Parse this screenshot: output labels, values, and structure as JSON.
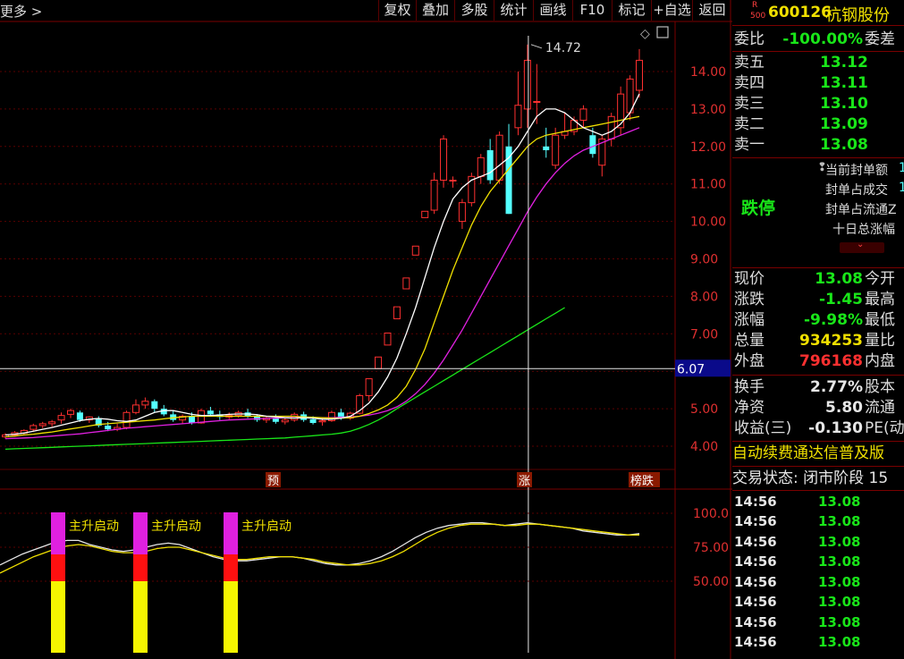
{
  "toolbar": {
    "more": "更多 >",
    "buttons": [
      "复权",
      "叠加",
      "多股",
      "统计",
      "画线",
      "F10",
      "标记",
      "+自选",
      "返回"
    ]
  },
  "chart": {
    "peak_label": "14.72",
    "crosshair_price": "6.07",
    "price_ticks": [
      "14.00",
      "13.00",
      "12.00",
      "11.00",
      "10.00",
      "9.00",
      "8.00",
      "7.00",
      "6.00",
      "5.00",
      "4.00"
    ],
    "indicator_ticks": [
      "100.0",
      "75.00",
      "50.00"
    ],
    "markers": {
      "pre": "预",
      "rise": "涨",
      "rank": "榜跌"
    },
    "signal_label": "主升启动",
    "colors": {
      "up": "#ff3030",
      "down": "#54ffff",
      "ma5": "#ffffff",
      "ma10": "#f0e000",
      "ma20": "#e020e0",
      "ma60": "#19e619"
    }
  },
  "chart_data": {
    "type": "candlestick",
    "ylim": [
      3.5,
      15.2
    ],
    "candles": [
      [
        4.25,
        4.35,
        4.3,
        4.2
      ],
      [
        4.3,
        4.4,
        4.36,
        4.26
      ],
      [
        4.35,
        4.45,
        4.42,
        4.3
      ],
      [
        4.45,
        4.6,
        4.55,
        4.4
      ],
      [
        4.55,
        4.65,
        4.6,
        4.48
      ],
      [
        4.6,
        4.7,
        4.65,
        4.52
      ],
      [
        4.7,
        4.9,
        4.82,
        4.6
      ],
      [
        4.85,
        5.0,
        4.95,
        4.75
      ],
      [
        4.9,
        4.95,
        4.7,
        4.65
      ],
      [
        4.7,
        4.8,
        4.78,
        4.62
      ],
      [
        4.75,
        4.8,
        4.55,
        4.5
      ],
      [
        4.55,
        4.65,
        4.45,
        4.4
      ],
      [
        4.45,
        4.6,
        4.5,
        4.4
      ],
      [
        4.5,
        4.95,
        4.9,
        4.45
      ],
      [
        4.9,
        5.25,
        5.1,
        4.85
      ],
      [
        5.1,
        5.3,
        5.2,
        5.0
      ],
      [
        5.2,
        5.25,
        5.0,
        4.9
      ],
      [
        5.0,
        5.1,
        4.85,
        4.8
      ],
      [
        4.85,
        4.95,
        4.7,
        4.65
      ],
      [
        4.7,
        4.85,
        4.8,
        4.6
      ],
      [
        4.8,
        4.9,
        4.62,
        4.58
      ],
      [
        4.62,
        5.0,
        4.95,
        4.6
      ],
      [
        4.95,
        5.05,
        4.85,
        4.8
      ],
      [
        4.85,
        4.95,
        4.78,
        4.7
      ],
      [
        4.78,
        4.9,
        4.82,
        4.72
      ],
      [
        4.82,
        4.95,
        4.9,
        4.76
      ],
      [
        4.9,
        5.0,
        4.8,
        4.75
      ],
      [
        4.8,
        4.85,
        4.7,
        4.65
      ],
      [
        4.7,
        4.8,
        4.75,
        4.62
      ],
      [
        4.75,
        4.85,
        4.65,
        4.6
      ],
      [
        4.65,
        4.75,
        4.7,
        4.58
      ],
      [
        4.7,
        4.9,
        4.85,
        4.65
      ],
      [
        4.85,
        4.92,
        4.7,
        4.65
      ],
      [
        4.72,
        4.8,
        4.62,
        4.58
      ],
      [
        4.65,
        4.75,
        4.68,
        4.55
      ],
      [
        4.68,
        4.95,
        4.9,
        4.65
      ],
      [
        4.9,
        5.0,
        4.75,
        4.7
      ],
      [
        4.75,
        4.92,
        4.88,
        4.7
      ],
      [
        4.88,
        5.4,
        5.35,
        4.85
      ],
      [
        5.35,
        5.8,
        5.8,
        5.2
      ],
      [
        6.07,
        6.38,
        6.38,
        6.07
      ],
      [
        6.7,
        7.02,
        7.02,
        6.7
      ],
      [
        7.4,
        7.72,
        7.72,
        7.4
      ],
      [
        8.2,
        8.49,
        8.49,
        8.2
      ],
      [
        9.1,
        9.34,
        9.34,
        9.1
      ],
      [
        10.1,
        10.27,
        10.27,
        10.1
      ],
      [
        10.3,
        11.3,
        11.1,
        10.2
      ],
      [
        11.1,
        12.3,
        12.2,
        10.9
      ],
      [
        11.1,
        11.2,
        11.1,
        10.9
      ],
      [
        10.0,
        10.6,
        10.5,
        9.8
      ],
      [
        10.5,
        11.3,
        11.2,
        10.4
      ],
      [
        11.2,
        11.8,
        11.7,
        11.0
      ],
      [
        11.9,
        12.2,
        11.1,
        11.0
      ],
      [
        11.1,
        12.4,
        12.3,
        11.0
      ],
      [
        12.0,
        12.6,
        10.2,
        10.2
      ],
      [
        12.5,
        14.0,
        13.1,
        12.3
      ],
      [
        13.0,
        14.72,
        14.3,
        12.5
      ],
      [
        13.2,
        14.2,
        13.2,
        12.6
      ],
      [
        12.0,
        12.5,
        11.9,
        11.7
      ],
      [
        11.5,
        12.5,
        12.3,
        11.4
      ],
      [
        12.3,
        12.9,
        12.4,
        12.2
      ],
      [
        12.4,
        12.8,
        12.7,
        12.3
      ],
      [
        12.7,
        13.1,
        13.0,
        12.5
      ],
      [
        12.3,
        12.5,
        11.8,
        11.7
      ],
      [
        11.5,
        12.3,
        12.2,
        11.2
      ],
      [
        12.2,
        12.9,
        12.8,
        12.0
      ],
      [
        12.5,
        13.6,
        13.4,
        12.3
      ],
      [
        12.9,
        13.9,
        13.8,
        12.7
      ],
      [
        13.5,
        14.6,
        14.3,
        13.3
      ]
    ],
    "ma5": [
      4.3,
      4.32,
      4.35,
      4.4,
      4.45,
      4.5,
      4.56,
      4.62,
      4.68,
      4.72,
      4.74,
      4.72,
      4.68,
      4.66,
      4.7,
      4.8,
      4.9,
      4.95,
      4.95,
      4.9,
      4.85,
      4.82,
      4.82,
      4.83,
      4.85,
      4.86,
      4.86,
      4.84,
      4.8,
      4.78,
      4.76,
      4.75,
      4.76,
      4.75,
      4.72,
      4.72,
      4.75,
      4.8,
      4.95,
      5.15,
      5.45,
      5.85,
      6.35,
      7.0,
      7.7,
      8.5,
      9.3,
      10.0,
      10.6,
      10.9,
      11.1,
      11.2,
      11.3,
      11.5,
      11.7,
      12.0,
      12.4,
      12.8,
      13.0,
      13.0,
      12.9,
      12.7,
      12.5,
      12.4,
      12.3,
      12.4,
      12.6,
      12.9,
      13.4
    ],
    "ma10": [
      4.25,
      4.27,
      4.3,
      4.32,
      4.35,
      4.38,
      4.42,
      4.46,
      4.5,
      4.54,
      4.58,
      4.6,
      4.62,
      4.64,
      4.66,
      4.68,
      4.7,
      4.73,
      4.76,
      4.78,
      4.8,
      4.8,
      4.8,
      4.8,
      4.8,
      4.8,
      4.8,
      4.8,
      4.8,
      4.8,
      4.8,
      4.8,
      4.78,
      4.77,
      4.76,
      4.75,
      4.75,
      4.76,
      4.8,
      4.87,
      4.97,
      5.1,
      5.3,
      5.6,
      6.05,
      6.6,
      7.3,
      8.0,
      8.7,
      9.3,
      9.9,
      10.4,
      10.8,
      11.1,
      11.4,
      11.7,
      12.0,
      12.2,
      12.3,
      12.35,
      12.4,
      12.45,
      12.5,
      12.55,
      12.6,
      12.65,
      12.7,
      12.75,
      12.8
    ],
    "ma20": [
      4.2,
      4.21,
      4.22,
      4.23,
      4.25,
      4.27,
      4.29,
      4.31,
      4.33,
      4.36,
      4.39,
      4.42,
      4.45,
      4.48,
      4.5,
      4.52,
      4.54,
      4.56,
      4.58,
      4.6,
      4.62,
      4.64,
      4.66,
      4.68,
      4.7,
      4.71,
      4.72,
      4.73,
      4.74,
      4.75,
      4.76,
      4.76,
      4.76,
      4.76,
      4.76,
      4.76,
      4.77,
      4.78,
      4.8,
      4.83,
      4.88,
      4.95,
      5.05,
      5.2,
      5.4,
      5.65,
      5.95,
      6.3,
      6.7,
      7.1,
      7.55,
      8.0,
      8.45,
      8.9,
      9.35,
      9.8,
      10.25,
      10.65,
      11.0,
      11.3,
      11.55,
      11.75,
      11.9,
      12.0,
      12.1,
      12.2,
      12.3,
      12.4,
      12.5
    ],
    "ma60": [
      3.92,
      3.93,
      3.94,
      3.95,
      3.96,
      3.97,
      3.98,
      3.99,
      4.0,
      4.01,
      4.02,
      4.03,
      4.04,
      4.05,
      4.06,
      4.07,
      4.08,
      4.09,
      4.1,
      4.11,
      4.12,
      4.13,
      4.14,
      4.15,
      4.16,
      4.17,
      4.18,
      4.19,
      4.2,
      4.21,
      4.22,
      4.24,
      4.26,
      4.28,
      4.3,
      4.32,
      4.35,
      4.4,
      4.48,
      4.58,
      4.7,
      4.84,
      5.0,
      5.15,
      5.3,
      5.45,
      5.6,
      5.75,
      5.9,
      6.05,
      6.2,
      6.35,
      6.5,
      6.65,
      6.8,
      6.95,
      7.1,
      7.25,
      7.4,
      7.55,
      7.7
    ],
    "indicator": {
      "ylim": [
        0,
        110
      ],
      "white": [
        62,
        66,
        70,
        73,
        76,
        79,
        80,
        80,
        77,
        75,
        73,
        72,
        73,
        75,
        77,
        78,
        77,
        74,
        71,
        68,
        66,
        65,
        65,
        66,
        67,
        68,
        68,
        67,
        65,
        63,
        62,
        62,
        63,
        65,
        68,
        72,
        77,
        82,
        86,
        89,
        91,
        92,
        93,
        93,
        92,
        91,
        92,
        93,
        92,
        91,
        90,
        89,
        87,
        86,
        85,
        84,
        84,
        85
      ],
      "yellow": [
        56,
        60,
        64,
        68,
        71,
        74,
        76,
        77,
        76,
        74,
        72,
        71,
        71,
        72,
        74,
        75,
        75,
        73,
        71,
        69,
        67,
        66,
        66,
        67,
        68,
        68,
        68,
        67,
        66,
        64,
        63,
        62,
        62,
        63,
        65,
        68,
        72,
        77,
        82,
        86,
        89,
        91,
        92,
        92,
        92,
        91,
        91,
        92,
        92,
        91,
        90,
        89,
        88,
        87,
        86,
        85,
        84,
        84
      ],
      "signal_indices": [
        1,
        3,
        5
      ]
    }
  },
  "stock": {
    "badge_top": "R",
    "badge_bottom": "500",
    "code": "600126",
    "name": "杭钢股份"
  },
  "order": {
    "webi_label": "委比",
    "webi_value": "-100.00%",
    "webi_label2": "委差",
    "asks": [
      {
        "label": "卖五",
        "price": "13.12"
      },
      {
        "label": "卖四",
        "price": "13.11"
      },
      {
        "label": "卖三",
        "price": "13.10"
      },
      {
        "label": "卖二",
        "price": "13.09"
      },
      {
        "label": "卖一",
        "price": "13.08"
      }
    ]
  },
  "limit": {
    "status": "跌停",
    "lines": [
      "当前封单额",
      "封单占成交",
      "封单占流通Z",
      "十日总涨幅"
    ],
    "line_values": [
      "1",
      "1",
      "",
      ""
    ]
  },
  "quote": [
    {
      "l1": "现价",
      "v": "13.08",
      "c": "green",
      "l2": "今开"
    },
    {
      "l1": "涨跌",
      "v": "-1.45",
      "c": "green",
      "l2": "最高"
    },
    {
      "l1": "涨幅",
      "v": "-9.98%",
      "c": "green",
      "l2": "最低"
    },
    {
      "l1": "总量",
      "v": "934253",
      "c": "yellow",
      "l2": "量比"
    },
    {
      "l1": "外盘",
      "v": "796168",
      "c": "red",
      "l2": "内盘"
    }
  ],
  "fund": [
    {
      "l1": "换手",
      "v": "2.77%",
      "l2": "股本"
    },
    {
      "l1": "净资",
      "v": "5.80",
      "l2": "流通"
    },
    {
      "l1": "收益(三)",
      "v": "-0.130",
      "l2": "PE(动"
    }
  ],
  "promo": "自动续费通达信普及版",
  "trade_status": "交易状态: 闭市阶段 15",
  "ticks": [
    {
      "t": "14:56",
      "p": "13.08"
    },
    {
      "t": "14:56",
      "p": "13.08"
    },
    {
      "t": "14:56",
      "p": "13.08"
    },
    {
      "t": "14:56",
      "p": "13.08"
    },
    {
      "t": "14:56",
      "p": "13.08"
    },
    {
      "t": "14:56",
      "p": "13.08"
    },
    {
      "t": "14:56",
      "p": "13.08"
    },
    {
      "t": "14:56",
      "p": "13.08"
    }
  ]
}
